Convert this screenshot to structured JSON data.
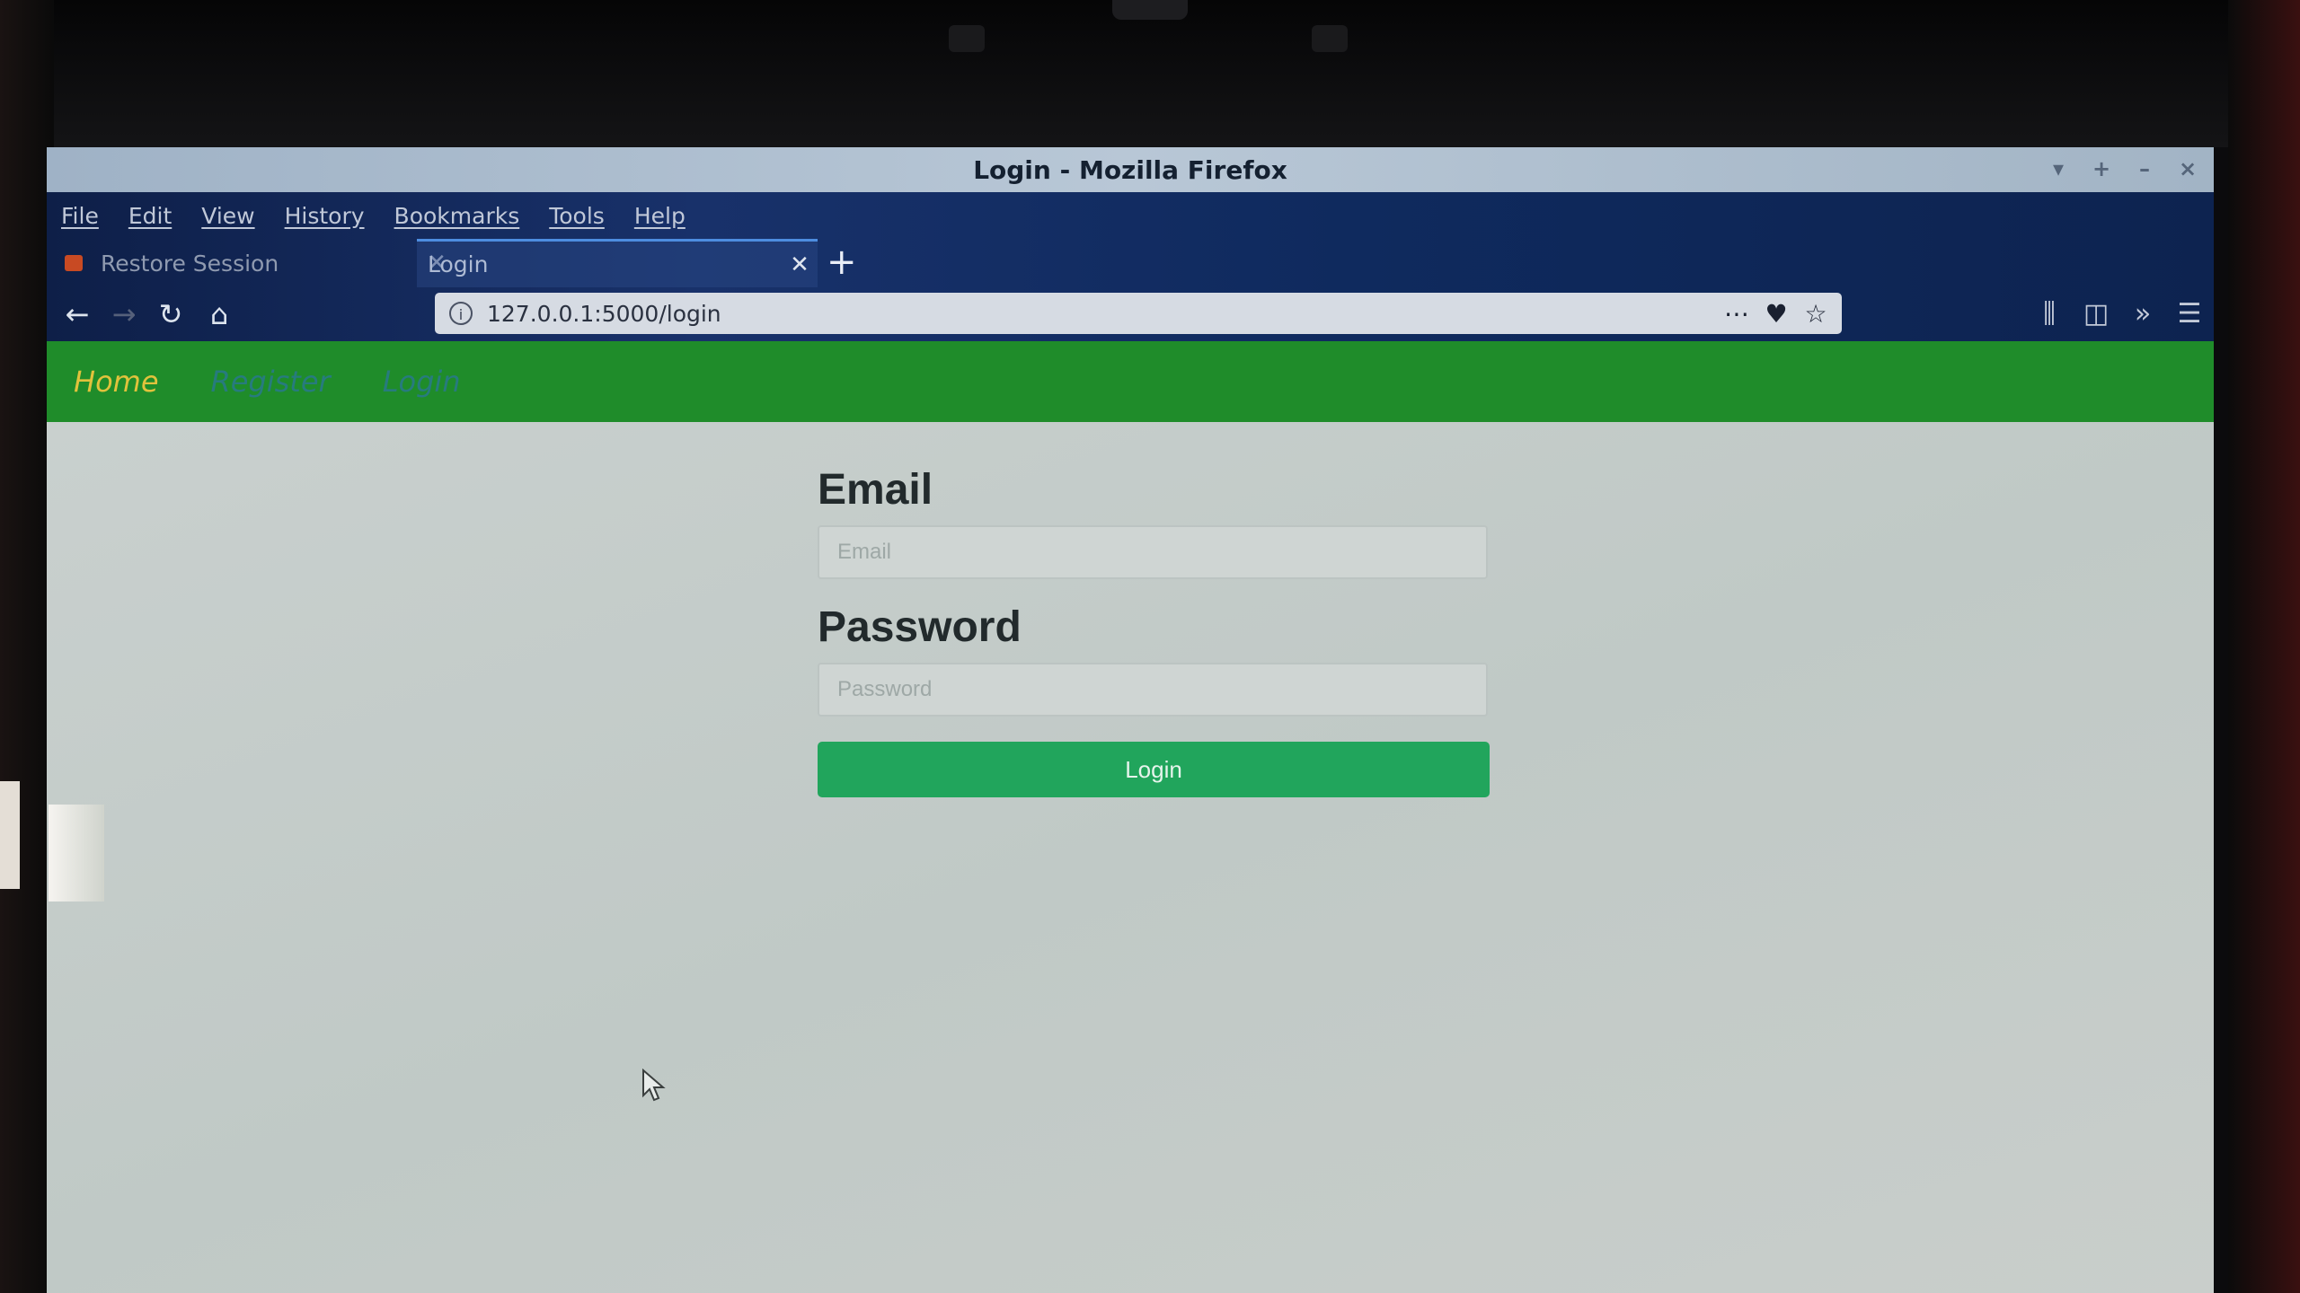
{
  "window": {
    "title": "Login - Mozilla Firefox",
    "controls": [
      "▾",
      "+",
      "–",
      "×"
    ]
  },
  "menu": [
    "File",
    "Edit",
    "View",
    "History",
    "Bookmarks",
    "Tools",
    "Help"
  ],
  "tabs": [
    {
      "label": "Restore Session",
      "active": false
    },
    {
      "label": "Login",
      "active": true
    }
  ],
  "navigation": {
    "url": "127.0.0.1:5000/login",
    "back_icon": "arrow-left-icon",
    "forward_icon": "arrow-right-icon",
    "reload_icon": "reload-icon",
    "home_icon": "home-icon",
    "url_actions": [
      "page-actions-icon",
      "pocket-icon",
      "bookmark-star-icon"
    ],
    "toolbar_icons": [
      "library-icon",
      "sidebar-icon",
      "overflow-icon",
      "hamburger-menu-icon"
    ]
  },
  "site_nav": {
    "home": "Home",
    "register": "Register",
    "login": "Login"
  },
  "form": {
    "email_label": "Email",
    "email_placeholder": "Email",
    "password_label": "Password",
    "password_placeholder": "Password",
    "submit_label": "Login"
  },
  "colors": {
    "site_nav_bg": "#1f8c2a",
    "home_link": "#e1c23c",
    "nav_link": "#2f6ec4",
    "login_button": "#21a55c",
    "page_bg": "#c5ccca"
  }
}
